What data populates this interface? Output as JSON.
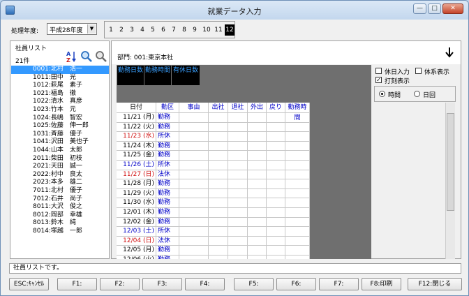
{
  "window": {
    "title": "就業データ入力"
  },
  "toolbar": {
    "fiscal_year_label": "処理年度:",
    "fiscal_year_value": "平成28年度",
    "months": [
      "1",
      "2",
      "3",
      "4",
      "5",
      "6",
      "7",
      "8",
      "9",
      "10",
      "11",
      "12"
    ],
    "active_month": "12"
  },
  "employee_list": {
    "title": "社員リスト",
    "count": "21件",
    "items": [
      "0001:北村　浩一",
      "1011:田中　光",
      "1012:萩尾　素子",
      "1021:福島　徹",
      "1022:清水　真彦",
      "1023:竹本　元",
      "1024:長嶋　智宏",
      "1025:佐藤　伸一郎",
      "1031:斉藤　優子",
      "1041:沢田　美也子",
      "1044:山本　太郎",
      "2011:柴田　初枝",
      "2021:天田　誠一",
      "2022:村中　良太",
      "2023:本多　雄二",
      "7011:北村　優子",
      "7012:石井　尚子",
      "8011:大沢　俊之",
      "8012:岡部　幸雄",
      "8013:鈴木　純",
      "8014:塚越　一郎"
    ]
  },
  "department": {
    "text": "部門: 001:東京本社"
  },
  "summary": {
    "headers": [
      "勤務日数",
      "勤務時間",
      "有休日数"
    ]
  },
  "options": {
    "holiday_input": "休日入力",
    "system_display": "体系表示",
    "punch_display": "打刻表示",
    "time_label": "時間",
    "day_label": "日回"
  },
  "grid": {
    "headers": [
      "日付",
      "勤区",
      "事由",
      "出社",
      "退社",
      "外出",
      "戻り",
      "勤務時間"
    ],
    "rows": [
      {
        "date": "11/21 (月)",
        "kind": "勤務",
        "date_color": "#000000",
        "kind_color": "#0000c8"
      },
      {
        "date": "11/22 (火)",
        "kind": "勤務",
        "date_color": "#000000",
        "kind_color": "#0000c8"
      },
      {
        "date": "11/23 (水)",
        "kind": "所休",
        "date_color": "#d01010",
        "kind_color": "#0000c8"
      },
      {
        "date": "11/24 (木)",
        "kind": "勤務",
        "date_color": "#000000",
        "kind_color": "#0000c8"
      },
      {
        "date": "11/25 (金)",
        "kind": "勤務",
        "date_color": "#000000",
        "kind_color": "#0000c8"
      },
      {
        "date": "11/26 (土)",
        "kind": "所休",
        "date_color": "#0000c8",
        "kind_color": "#0000c8"
      },
      {
        "date": "11/27 (日)",
        "kind": "法休",
        "date_color": "#d01010",
        "kind_color": "#0000c8"
      },
      {
        "date": "11/28 (月)",
        "kind": "勤務",
        "date_color": "#000000",
        "kind_color": "#0000c8"
      },
      {
        "date": "11/29 (火)",
        "kind": "勤務",
        "date_color": "#000000",
        "kind_color": "#0000c8"
      },
      {
        "date": "11/30 (水)",
        "kind": "勤務",
        "date_color": "#000000",
        "kind_color": "#0000c8"
      },
      {
        "date": "12/01 (木)",
        "kind": "勤務",
        "date_color": "#000000",
        "kind_color": "#0000c8"
      },
      {
        "date": "12/02 (金)",
        "kind": "勤務",
        "date_color": "#000000",
        "kind_color": "#0000c8"
      },
      {
        "date": "12/03 (土)",
        "kind": "所休",
        "date_color": "#0000c8",
        "kind_color": "#0000c8"
      },
      {
        "date": "12/04 (日)",
        "kind": "法休",
        "date_color": "#d01010",
        "kind_color": "#0000c8"
      },
      {
        "date": "12/05 (月)",
        "kind": "勤務",
        "date_color": "#000000",
        "kind_color": "#0000c8"
      },
      {
        "date": "12/06 (火)",
        "kind": "勤務",
        "date_color": "#000000",
        "kind_color": "#0000c8"
      }
    ]
  },
  "status_bar": {
    "message": "社員リストです。"
  },
  "function_keys": [
    "ESC:ｷｬﾝｾﾙ",
    "F1:",
    "F2:",
    "F3:",
    "F4:",
    "F5:",
    "F6:",
    "F7:",
    "F8:印刷",
    "F12:閉じる"
  ]
}
